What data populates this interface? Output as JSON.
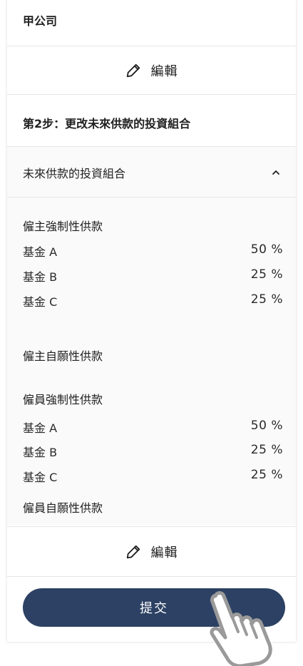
{
  "company": "甲公司",
  "edit_label": "編輯",
  "step_title": "第2步：更改未來供款的投資組合",
  "accordion": {
    "title": "未來供款的投資組合",
    "expanded": true
  },
  "groups": [
    {
      "title": "僱主強制性供款",
      "funds": [
        {
          "name": "基金 A",
          "pct": "50 %"
        },
        {
          "name": "基金 B",
          "pct": "25 %"
        },
        {
          "name": "基金 C",
          "pct": "25 %"
        }
      ]
    },
    {
      "title": "僱主自願性供款",
      "funds": []
    },
    {
      "title": "僱員強制性供款",
      "funds": [
        {
          "name": "基金 A",
          "pct": "50 %"
        },
        {
          "name": "基金 B",
          "pct": "25 %"
        },
        {
          "name": "基金 C",
          "pct": "25 %"
        }
      ]
    },
    {
      "title": "僱員自願性供款",
      "funds": []
    }
  ],
  "submit_label": "提交",
  "colors": {
    "primary": "#2c4163",
    "divider": "#e6e6e6",
    "panel_bg": "#fafafa"
  }
}
